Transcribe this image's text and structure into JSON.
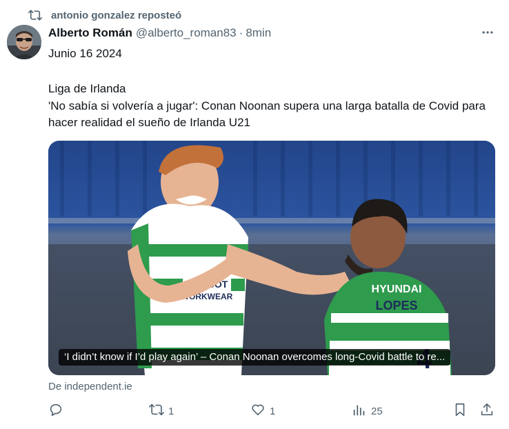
{
  "repost": {
    "icon": "repost-icon",
    "text": "antonio gonzalez reposteó"
  },
  "post": {
    "author": {
      "name": "Alberto Román",
      "handle": "@alberto_roman83",
      "separator": "·",
      "time": "8min",
      "avatar_icon": "avatar-photo"
    },
    "date_line": "Junio 16 2024",
    "body_lines": [
      "Liga de Irlanda",
      "'No sabía si volvería a jugar': Conan Noonan supera una larga batalla de Covid para hacer realidad el sueño de Irlanda U21"
    ],
    "card": {
      "caption": "‘I didn’t know if I’d play again’ – Conan Noonan overcomes long-Covid battle to re...",
      "shirt_text_left": "MASCOT WORKWEAR",
      "shirt_text_right": "HYUNDAI",
      "shirt_name": "LOPES"
    },
    "source": "De independent.ie"
  },
  "actions": {
    "reply": {
      "icon": "reply-icon",
      "count": ""
    },
    "repost": {
      "icon": "repost-icon",
      "count": "1"
    },
    "like": {
      "icon": "heart-icon",
      "count": "1"
    },
    "views": {
      "icon": "analytics-icon",
      "count": "25"
    },
    "bookmark": {
      "icon": "bookmark-icon"
    },
    "share": {
      "icon": "share-icon"
    }
  },
  "colors": {
    "text_primary": "#0f1419",
    "text_secondary": "#536471",
    "caption_bg": "#000000"
  }
}
